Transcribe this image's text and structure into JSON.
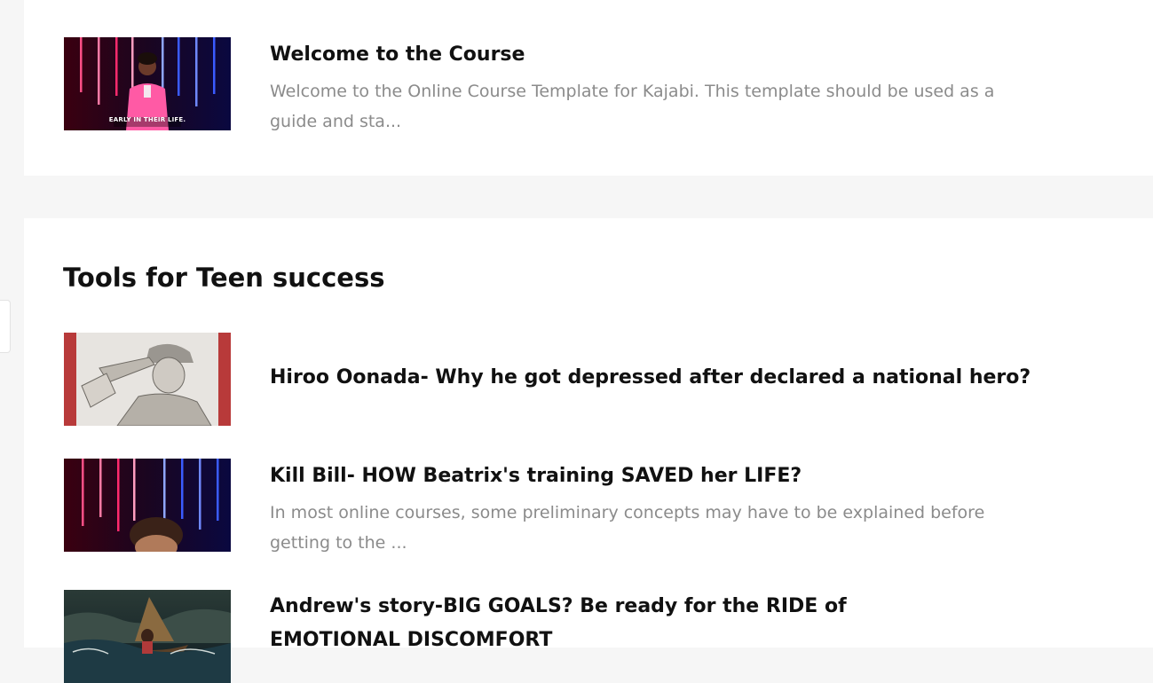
{
  "top_lesson": {
    "title": "Welcome to the Course",
    "description": "Welcome to the Online Course Template for Kajabi. This template should be used as a guide and sta...",
    "thumbnail_caption": "EARLY IN THEIR LIFE."
  },
  "section": {
    "title": "Tools for Teen success",
    "lessons": [
      {
        "title": "Hiroo Oonada- Why he got depressed after declared a national hero?",
        "description": ""
      },
      {
        "title": "Kill Bill- HOW Beatrix's training SAVED her LIFE?",
        "description": "In most online courses, some preliminary concepts may have to be explained before getting to the ..."
      },
      {
        "title": "Andrew's story-BIG GOALS? Be ready for the RIDE of EMOTIONAL DISCOMFORT",
        "description": ""
      }
    ]
  },
  "colors": {
    "page_background": "#f6f6f6",
    "card_background": "#ffffff",
    "title_text": "#111111",
    "description_text": "#8b8b8b",
    "neon_pink": "#ff2a6d",
    "neon_blue": "#3a5bff"
  }
}
